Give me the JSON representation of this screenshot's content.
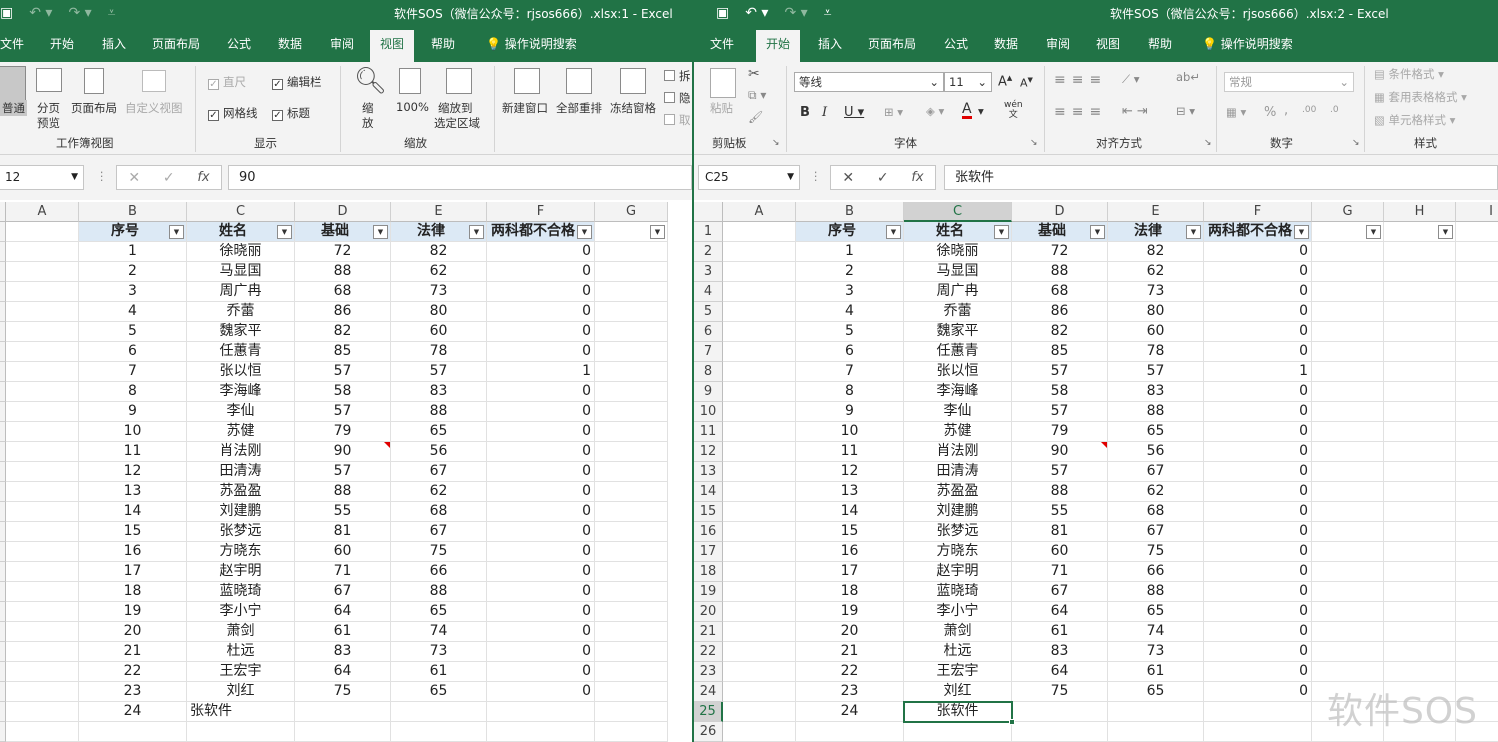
{
  "left": {
    "title": "软件SOS（微信公众号：rjsos666）.xlsx:1  -  Excel",
    "tabs": [
      "文件",
      "开始",
      "插入",
      "页面布局",
      "公式",
      "数据",
      "审阅",
      "视图",
      "帮助"
    ],
    "active_tab": "视图",
    "tell_me": "操作说明搜索",
    "ribbon": {
      "views": {
        "normal": "普通",
        "page_break_1": "分页",
        "page_break_2": "预览",
        "page_layout": "页面布局",
        "custom": "自定义视图",
        "group": "工作簿视图"
      },
      "show": {
        "ruler": "直尺",
        "formula_bar": "编辑栏",
        "gridlines": "网格线",
        "headings": "标题",
        "group": "显示"
      },
      "zoom": {
        "zoom_1": "缩",
        "zoom_2": "放",
        "hundred": "100%",
        "to_sel_1": "缩放到",
        "to_sel_2": "选定区域",
        "group": "缩放"
      },
      "window": {
        "new": "新建窗口",
        "arrange": "全部重排",
        "freeze": "冻结窗格",
        "split": "拆",
        "hide": "隐",
        "unhide": "取"
      }
    },
    "name_box": "12",
    "formula": "90",
    "columns": [
      "A",
      "B",
      "C",
      "D",
      "E",
      "F",
      "G"
    ]
  },
  "right": {
    "title": "软件SOS（微信公众号：rjsos666）.xlsx:2  -  Excel",
    "tabs": [
      "文件",
      "开始",
      "插入",
      "页面布局",
      "公式",
      "数据",
      "审阅",
      "视图",
      "帮助"
    ],
    "active_tab": "开始",
    "tell_me": "操作说明搜索",
    "ribbon": {
      "clipboard": {
        "paste": "粘贴",
        "group": "剪贴板"
      },
      "font": {
        "name": "等线",
        "size": "11",
        "bold": "B",
        "italic": "I",
        "underline": "U",
        "group": "字体",
        "grow": "A",
        "shrink": "A",
        "pinyin": "wén",
        "pinyin2": "文"
      },
      "alignment": {
        "group": "对齐方式"
      },
      "number": {
        "format": "常规",
        "percent": "%",
        "comma": ",",
        "group": "数字",
        "dec_inc": ".00",
        "dec_dec": ".0"
      },
      "styles": {
        "conditional": "条件格式",
        "table": "套用表格格式",
        "cell": "单元格样式",
        "group": "样式"
      }
    },
    "name_box": "C25",
    "formula": "张软件",
    "columns": [
      "A",
      "B",
      "C",
      "D",
      "E",
      "F",
      "G",
      "H",
      "I"
    ],
    "row_numbers": [
      "1",
      "2",
      "3",
      "4",
      "5",
      "6",
      "7",
      "8",
      "9",
      "10",
      "11",
      "12",
      "13",
      "14",
      "15",
      "16",
      "17",
      "18",
      "19",
      "20",
      "21",
      "22",
      "23",
      "24",
      "25",
      "26"
    ]
  },
  "table": {
    "headers": [
      "序号",
      "姓名",
      "基础",
      "法律",
      "两科都不合格"
    ],
    "rows": [
      [
        "1",
        "徐晓丽",
        "72",
        "82",
        "0"
      ],
      [
        "2",
        "马显国",
        "88",
        "62",
        "0"
      ],
      [
        "3",
        "周广冉",
        "68",
        "73",
        "0"
      ],
      [
        "4",
        "乔蕾",
        "86",
        "80",
        "0"
      ],
      [
        "5",
        "魏家平",
        "82",
        "60",
        "0"
      ],
      [
        "6",
        "任蕙青",
        "85",
        "78",
        "0"
      ],
      [
        "7",
        "张以恒",
        "57",
        "57",
        "1"
      ],
      [
        "8",
        "李海峰",
        "58",
        "83",
        "0"
      ],
      [
        "9",
        "李仙",
        "57",
        "88",
        "0"
      ],
      [
        "10",
        "苏健",
        "79",
        "65",
        "0"
      ],
      [
        "11",
        "肖法刚",
        "90",
        "56",
        "0"
      ],
      [
        "12",
        "田清涛",
        "57",
        "67",
        "0"
      ],
      [
        "13",
        "苏盈盈",
        "88",
        "62",
        "0"
      ],
      [
        "14",
        "刘建鹏",
        "55",
        "68",
        "0"
      ],
      [
        "15",
        "张梦远",
        "81",
        "67",
        "0"
      ],
      [
        "16",
        "方晓东",
        "60",
        "75",
        "0"
      ],
      [
        "17",
        "赵宇明",
        "71",
        "66",
        "0"
      ],
      [
        "18",
        "蓝晓琦",
        "67",
        "88",
        "0"
      ],
      [
        "19",
        "李小宁",
        "64",
        "65",
        "0"
      ],
      [
        "20",
        "萧剑",
        "61",
        "74",
        "0"
      ],
      [
        "21",
        "杜远",
        "83",
        "73",
        "0"
      ],
      [
        "22",
        "王宏宇",
        "64",
        "61",
        "0"
      ],
      [
        "23",
        "刘红",
        "75",
        "65",
        "0"
      ]
    ],
    "last_row": [
      "24",
      "张软件"
    ]
  },
  "watermark": "软件SOS",
  "colors": {
    "excel_green": "#217346",
    "header_fill": "#dce9f5",
    "comment_red": "#e00000"
  }
}
